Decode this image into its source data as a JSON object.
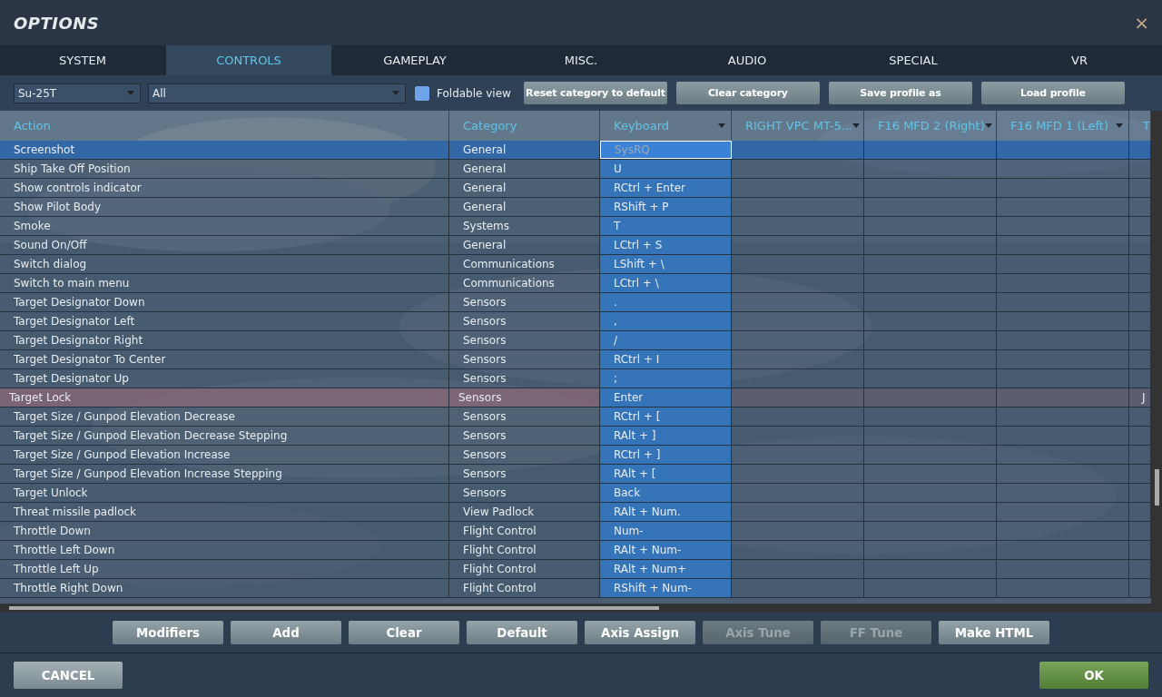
{
  "window": {
    "title": "OPTIONS",
    "close": "×"
  },
  "tabs": [
    {
      "label": "SYSTEM",
      "selected": false
    },
    {
      "label": "CONTROLS",
      "selected": true
    },
    {
      "label": "GAMEPLAY",
      "selected": false
    },
    {
      "label": "MISC.",
      "selected": false
    },
    {
      "label": "AUDIO",
      "selected": false
    },
    {
      "label": "SPECIAL",
      "selected": false
    },
    {
      "label": "VR",
      "selected": false
    }
  ],
  "toolbar": {
    "aircraft": "Su-25T",
    "category": "All",
    "foldable_view": {
      "label": "Foldable view",
      "checked": true
    },
    "buttons": [
      "Reset category to default",
      "Clear category",
      "Save profile as",
      "Load profile"
    ]
  },
  "table": {
    "columns": [
      {
        "label": "Action",
        "dropdown": false
      },
      {
        "label": "Category",
        "dropdown": false
      },
      {
        "label": "Keyboard",
        "dropdown": true
      },
      {
        "label": "RIGHT VPC MT-5...",
        "dropdown": true
      },
      {
        "label": "F16 MFD 2 (Right)",
        "dropdown": true
      },
      {
        "label": "F16 MFD 1 (Left)",
        "dropdown": true
      },
      {
        "label": "T"
      }
    ],
    "rows": [
      {
        "action": "Screenshot",
        "category": "General",
        "keyboard": "SysRQ",
        "selected": true,
        "conflict": false
      },
      {
        "action": "Ship Take Off Position",
        "category": "General",
        "keyboard": "U",
        "selected": false,
        "conflict": false
      },
      {
        "action": "Show controls indicator",
        "category": "General",
        "keyboard": "RCtrl + Enter",
        "selected": false,
        "conflict": false
      },
      {
        "action": "Show Pilot Body",
        "category": "General",
        "keyboard": "RShift + P",
        "selected": false,
        "conflict": false
      },
      {
        "action": "Smoke",
        "category": "Systems",
        "keyboard": "T",
        "selected": false,
        "conflict": false
      },
      {
        "action": "Sound On/Off",
        "category": "General",
        "keyboard": "LCtrl + S",
        "selected": false,
        "conflict": false
      },
      {
        "action": "Switch dialog",
        "category": "Communications",
        "keyboard": "LShift + \\",
        "selected": false,
        "conflict": false
      },
      {
        "action": "Switch to main menu",
        "category": "Communications",
        "keyboard": "LCtrl + \\",
        "selected": false,
        "conflict": false
      },
      {
        "action": "Target Designator Down",
        "category": "Sensors",
        "keyboard": ".",
        "selected": false,
        "conflict": false
      },
      {
        "action": "Target Designator Left",
        "category": "Sensors",
        "keyboard": ",",
        "selected": false,
        "conflict": false
      },
      {
        "action": "Target Designator Right",
        "category": "Sensors",
        "keyboard": "/",
        "selected": false,
        "conflict": false
      },
      {
        "action": "Target Designator To Center",
        "category": "Sensors",
        "keyboard": "RCtrl + I",
        "selected": false,
        "conflict": false
      },
      {
        "action": "Target Designator Up",
        "category": "Sensors",
        "keyboard": ";",
        "selected": false,
        "conflict": false
      },
      {
        "action": "Target Lock",
        "category": "Sensors",
        "keyboard": "Enter",
        "selected": false,
        "conflict": true,
        "column_7": "J"
      },
      {
        "action": "Target Size / Gunpod Elevation Decrease",
        "category": "Sensors",
        "keyboard": "RCtrl + [",
        "selected": false,
        "conflict": false
      },
      {
        "action": "Target Size / Gunpod Elevation Decrease Stepping",
        "category": "Sensors",
        "keyboard": "RAlt + ]",
        "selected": false,
        "conflict": false
      },
      {
        "action": "Target Size / Gunpod Elevation Increase",
        "category": "Sensors",
        "keyboard": "RCtrl + ]",
        "selected": false,
        "conflict": false
      },
      {
        "action": "Target Size / Gunpod Elevation Increase Stepping",
        "category": "Sensors",
        "keyboard": "RAlt + [",
        "selected": false,
        "conflict": false
      },
      {
        "action": "Target Unlock",
        "category": "Sensors",
        "keyboard": "Back",
        "selected": false,
        "conflict": false
      },
      {
        "action": "Threat missile padlock",
        "category": "View Padlock",
        "keyboard": "RAlt + Num.",
        "selected": false,
        "conflict": false
      },
      {
        "action": "Throttle Down",
        "category": "Flight Control",
        "keyboard": "Num-",
        "selected": false,
        "conflict": false
      },
      {
        "action": "Throttle Left Down",
        "category": "Flight Control",
        "keyboard": "RAlt + Num-",
        "selected": false,
        "conflict": false
      },
      {
        "action": "Throttle Left Up",
        "category": "Flight Control",
        "keyboard": "RAlt + Num+",
        "selected": false,
        "conflict": false
      },
      {
        "action": "Throttle Right Down",
        "category": "Flight Control",
        "keyboard": "RShift + Num-",
        "selected": false,
        "conflict": false
      }
    ]
  },
  "actions": [
    {
      "label": "Modifiers",
      "disabled": false
    },
    {
      "label": "Add",
      "disabled": false
    },
    {
      "label": "Clear",
      "disabled": false
    },
    {
      "label": "Default",
      "disabled": false
    },
    {
      "label": "Axis Assign",
      "disabled": false
    },
    {
      "label": "Axis Tune",
      "disabled": true
    },
    {
      "label": "FF Tune",
      "disabled": true
    },
    {
      "label": "Make HTML",
      "disabled": false
    }
  ],
  "footer": {
    "cancel": "CANCEL",
    "ok": "OK"
  }
}
